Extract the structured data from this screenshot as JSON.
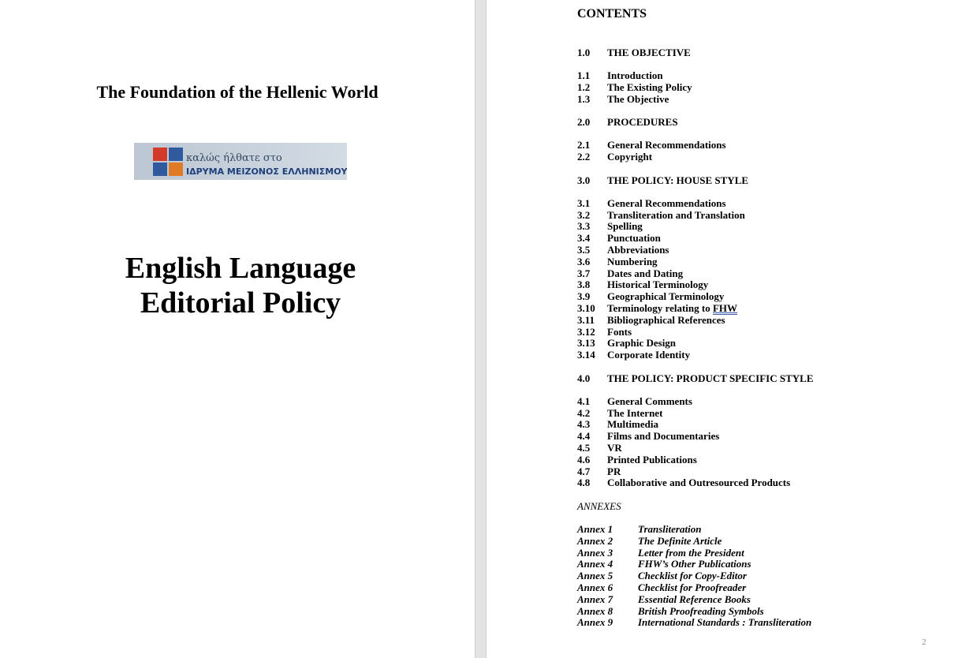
{
  "left_page": {
    "organization": "The Foundation of the Hellenic World",
    "logo": {
      "line1": "καλώς ήλθατε στο",
      "line2": "ΙΔΡΥΜΑ ΜΕΙΖΟΝΟΣ ΕΛΛΗΝΙΣΜΟΥ"
    },
    "title_line1": "English Language",
    "title_line2": "Editorial Policy"
  },
  "right_page": {
    "heading": "CONTENTS",
    "entries": [
      {
        "num": "1.0",
        "text": "THE OBJECTIVE"
      },
      {
        "num": "1.1",
        "text": "Introduction"
      },
      {
        "num": "1.2",
        "text": "The Existing Policy"
      },
      {
        "num": "1.3",
        "text": "The Objective"
      },
      {
        "num": "2.0",
        "text": "PROCEDURES"
      },
      {
        "num": "2.1",
        "text": "General Recommendations"
      },
      {
        "num": "2.2",
        "text": "Copyright"
      },
      {
        "num": "3.0",
        "text": "THE POLICY: HOUSE STYLE"
      },
      {
        "num": "3.1",
        "text": "General Recommendations"
      },
      {
        "num": "3.2",
        "text": "Transliteration and Translation"
      },
      {
        "num": "3.3",
        "text": "Spelling"
      },
      {
        "num": "3.4",
        "text": "Punctuation"
      },
      {
        "num": "3.5",
        "text": "Abbreviations"
      },
      {
        "num": "3.6",
        "text": "Numbering"
      },
      {
        "num": "3.7",
        "text": "Dates and Dating"
      },
      {
        "num": "3.8",
        "text": "Historical Terminology"
      },
      {
        "num": "3.9",
        "text": "Geographical Terminology"
      },
      {
        "num": "3.10",
        "text": "Terminology relating to ",
        "text_b": "FHW"
      },
      {
        "num": "3.11",
        "text": "Bibliographical References"
      },
      {
        "num": "3.12",
        "text": "Fonts"
      },
      {
        "num": "3.13",
        "text": "Graphic Design"
      },
      {
        "num": "3.14",
        "text": "Corporate Identity"
      },
      {
        "num": "4.0",
        "text": "THE POLICY: PRODUCT SPECIFIC STYLE"
      },
      {
        "num": "4.1",
        "text": "General Comments"
      },
      {
        "num": "4.2",
        "text": "The Internet"
      },
      {
        "num": "4.3",
        "text": "Multimedia"
      },
      {
        "num": "4.4",
        "text": "Films and Documentaries"
      },
      {
        "num": "4.5",
        "text": "VR"
      },
      {
        "num": "4.6",
        "text": "Printed Publications"
      },
      {
        "num": "4.7",
        "text": "PR"
      },
      {
        "num": "4.8",
        "text": "Collaborative and Outresourced Products"
      }
    ],
    "annexes_heading": "ANNEXES",
    "annexes": [
      {
        "num": "Annex 1",
        "text": "Transliteration"
      },
      {
        "num": "Annex 2",
        "text": "The Definite Article"
      },
      {
        "num": "Annex 3",
        "text": "Letter from the President"
      },
      {
        "num": "Annex 4",
        "text": "FHW’s Other Publications"
      },
      {
        "num": "Annex 5",
        "text": "Checklist for Copy-Editor"
      },
      {
        "num": "Annex 6",
        "text": "Checklist for Proofreader"
      },
      {
        "num": "Annex 7",
        "text": "Essential Reference Books"
      },
      {
        "num": "Annex 8",
        "text": "British Proofreading Symbols"
      },
      {
        "num": "Annex 9",
        "text": "International Standards : Transliteration"
      }
    ],
    "page_number": "2"
  }
}
